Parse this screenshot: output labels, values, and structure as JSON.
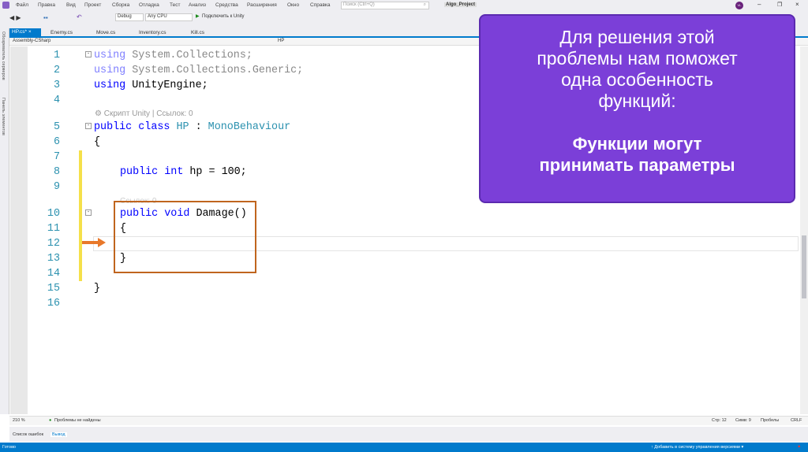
{
  "menu": [
    "Файл",
    "Правка",
    "Вид",
    "Проект",
    "Сборка",
    "Отладка",
    "Тест",
    "Анализ",
    "Средства",
    "Расширения",
    "Окно",
    "Справка"
  ],
  "search_placeholder": "Поиск (Ctrl+Q)",
  "project_name": "Algo_Project",
  "avatar": "VL",
  "toolbar": {
    "config": "Debug",
    "platform": "Any CPU",
    "attach": "Подключить к Unity"
  },
  "tabs": [
    "HP.cs*",
    "Enemy.cs",
    "Move.cs",
    "Inventory.cs",
    "Kill.cs"
  ],
  "nav": {
    "project": "Assembly-CSharp",
    "class": "HP"
  },
  "side_panels": [
    "Обозреватель серверов",
    "Панель элементов"
  ],
  "lines": [
    "1",
    "2",
    "3",
    "4",
    "5",
    "6",
    "7",
    "8",
    "9",
    "10",
    "11",
    "12",
    "13",
    "14",
    "15",
    "16"
  ],
  "code": {
    "l1a": "using",
    "l1b": " System.Collections;",
    "l2a": "using",
    "l2b": " System.Collections.Generic;",
    "l3a": "using",
    "l3b": " UnityEngine;",
    "lens1": "⚙ Скрипт Unity | Ссылок: 0",
    "l5a": "public class",
    "l5b": " HP ",
    "l5c": ": ",
    "l5d": "MonoBehaviour",
    "l6": "{",
    "l8a": "public int",
    "l8b": " hp = 100;",
    "lens2": "Ссылок: 0",
    "l10a": "public void",
    "l10b": " Damage()",
    "l11": "{",
    "l13": "}",
    "l15": "}"
  },
  "overlay": {
    "text1": "Для решения этой",
    "text2": "проблемы нам поможет",
    "text3": "одна особенность",
    "text4": "функций:",
    "bold1": "Функции могут",
    "bold2": "принимать параметры"
  },
  "status": {
    "zoom": "210 %",
    "problems": "Проблемы не найдены",
    "line": "Стр: 12",
    "col": "Симв: 9",
    "spaces": "Пробелы",
    "eol": "CRLF"
  },
  "bottom_tabs": [
    "Список ошибок",
    "Вывод"
  ],
  "statusbar": {
    "ready": "Готово",
    "vcs": "↑ Добавить в систему управления версиями ▾"
  },
  "colors": {
    "accent": "#007acc",
    "overlay": "#7b3fd8",
    "highlight_box": "#c0651e",
    "change_bar": "#f5e04a"
  }
}
